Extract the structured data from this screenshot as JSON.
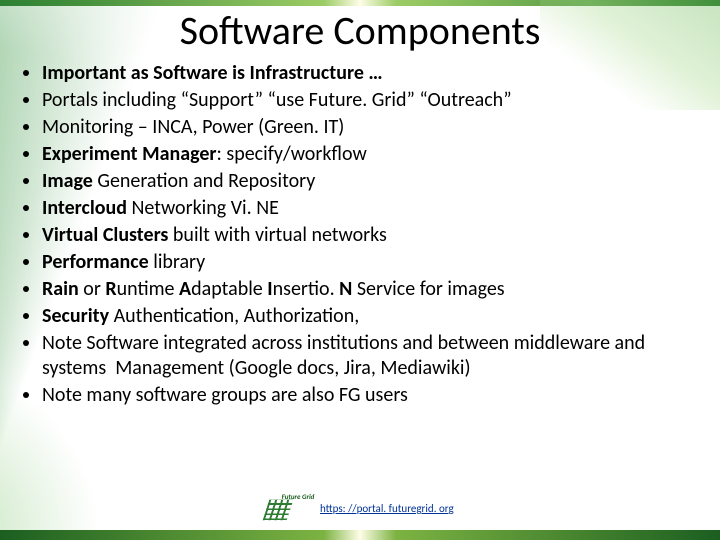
{
  "title": "Software Components",
  "bullets": [
    {
      "html": "<b>Important as Software is Infrastructure …</b>"
    },
    {
      "html": "Portals including “Support” “use Future. Grid” “Outreach”"
    },
    {
      "html": "Monitoring – INCA, Power (Green. IT)"
    },
    {
      "html": "<b>Experiment Manager</b>: specify/workflow"
    },
    {
      "html": "<b>Image</b> Generation and Repository"
    },
    {
      "html": "<b>Intercloud</b> Networking Vi. NE"
    },
    {
      "html": "<b>Virtual Clusters</b> built with virtual networks"
    },
    {
      "html": "<b>Performance</b> library"
    },
    {
      "html": "<b>Rain</b> or <b>R</b>untime <b>A</b>daptable <b>I</b>nsertio. <b>N</b> Service for images"
    },
    {
      "html": "<b>Security</b> Authentication, Authorization,"
    },
    {
      "html": "Note Software integrated across institutions and between middleware and systems  Management (Google docs, Jira, Mediawiki)"
    },
    {
      "html": "Note many software groups are also FG users"
    }
  ],
  "footer": {
    "url_text": "https: //portal. futuregrid. org",
    "logo_text": "Future\nGrid"
  }
}
